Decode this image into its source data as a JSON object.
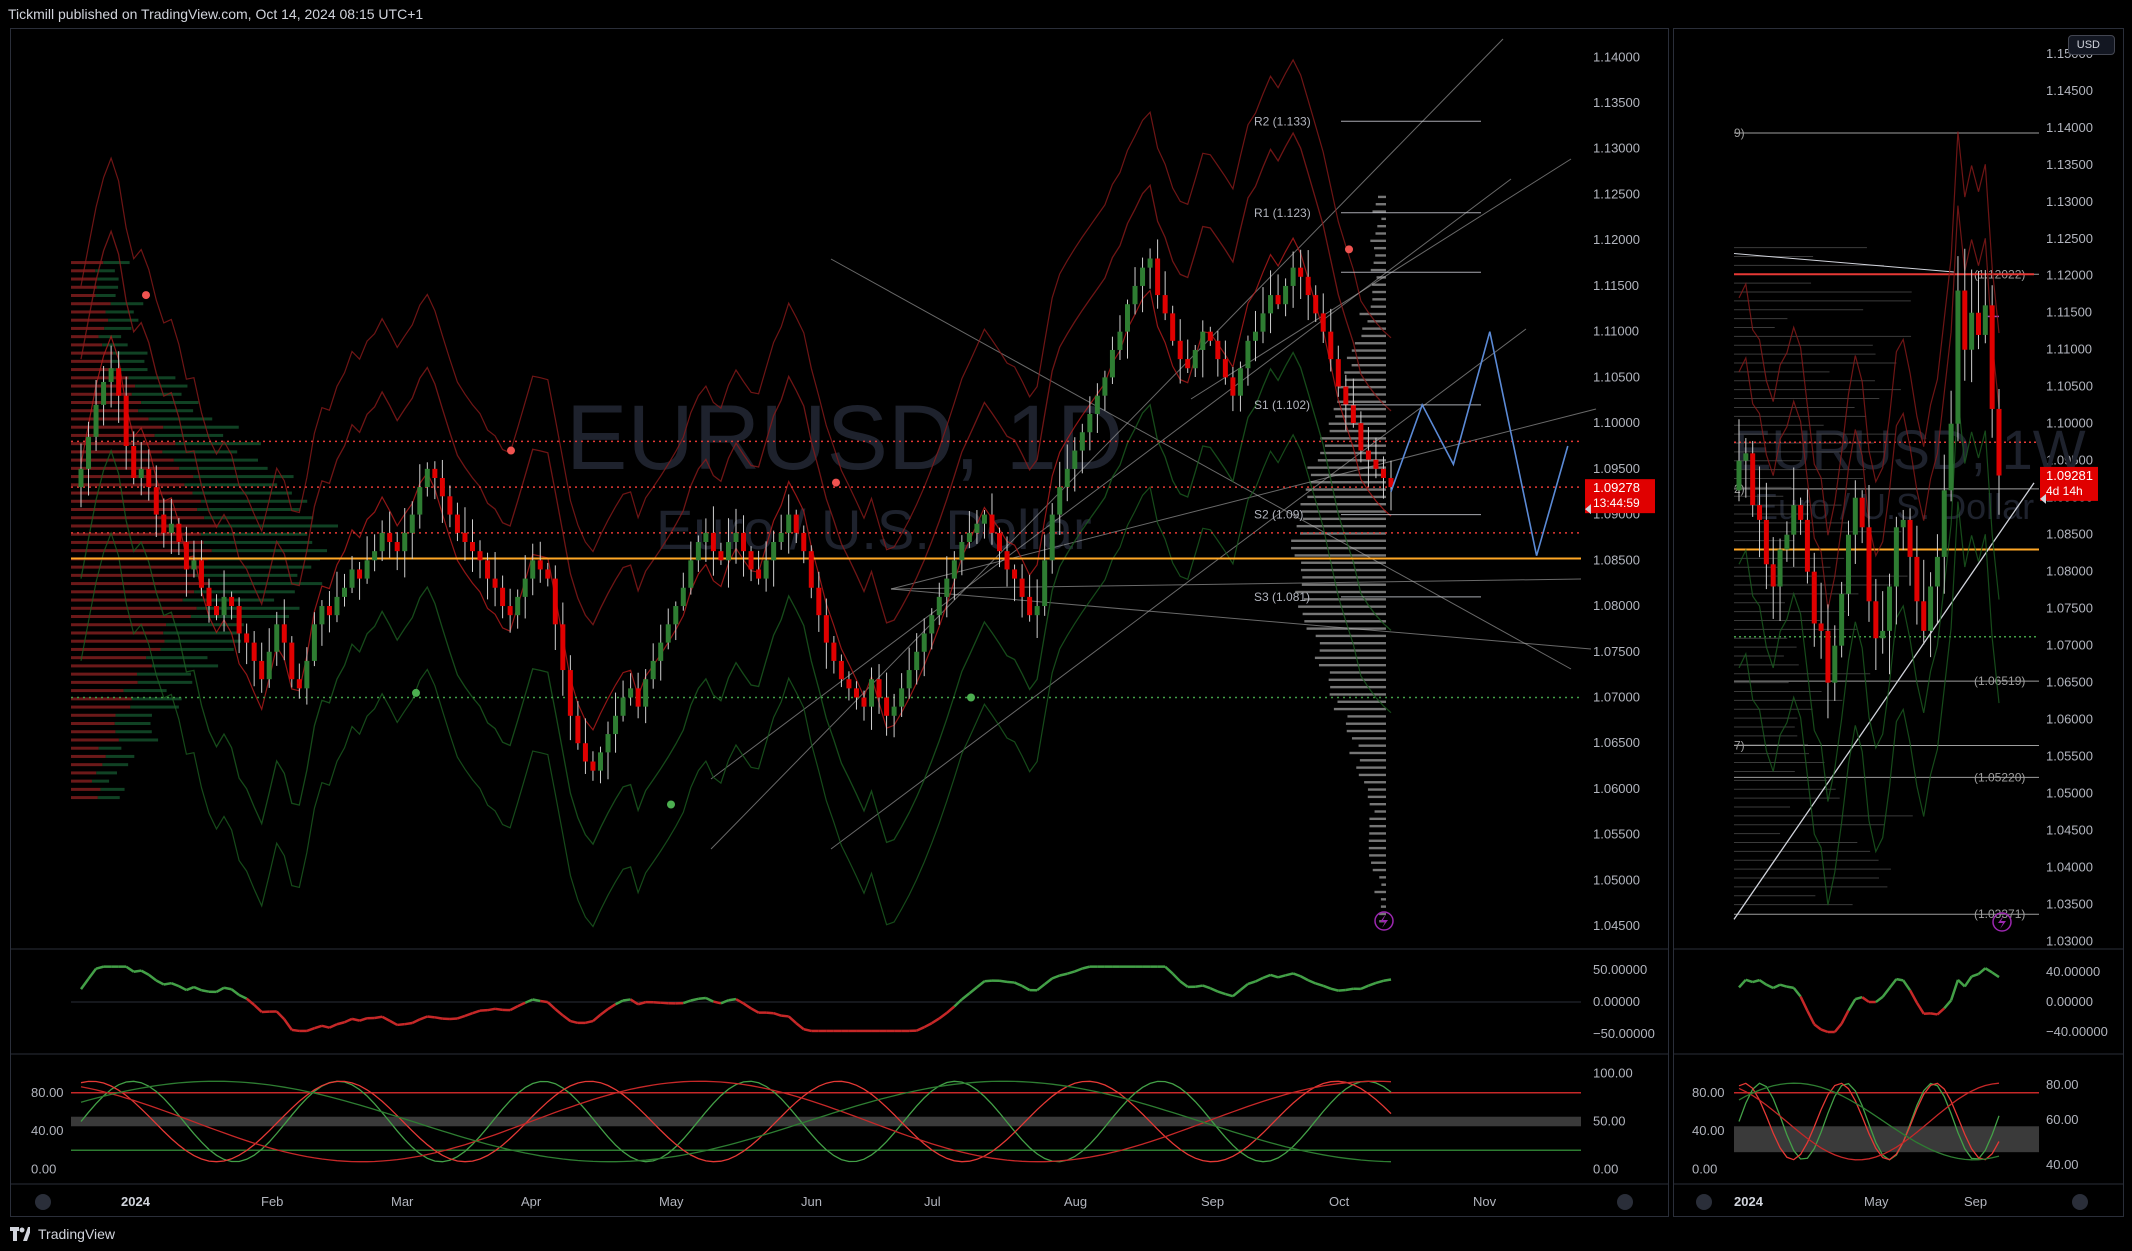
{
  "publisher": "Tickmill published on TradingView.com, Oct 14, 2024 08:15 UTC+1",
  "brand": "TradingView",
  "currency": "USD",
  "colors": {
    "bull": "#2e7d32",
    "bear": "#e00000",
    "grid": "#2a2e39",
    "axis_text": "#b2b5be",
    "price_badge": "#e00000",
    "support_line": "#ffa726"
  },
  "chart_data": [
    {
      "type": "candlestick",
      "watermark_symbol": "EURUSD, 1D",
      "watermark_name": "Euro / U.S. Dollar",
      "x_ticks": [
        "2024",
        "Feb",
        "Mar",
        "Apr",
        "May",
        "Jun",
        "Jul",
        "Aug",
        "Sep",
        "Oct",
        "Nov"
      ],
      "y_ticks": [
        "1.14000",
        "1.13500",
        "1.13000",
        "1.12500",
        "1.12000",
        "1.11500",
        "1.11000",
        "1.10500",
        "1.10000",
        "1.09500",
        "1.09000",
        "1.08500",
        "1.08000",
        "1.07500",
        "1.07000",
        "1.06500",
        "1.06000",
        "1.05500",
        "1.05000",
        "1.04500"
      ],
      "ylim": [
        1.0425,
        1.142
      ],
      "last_price": "1.09278",
      "countdown": "13:44:59",
      "pivot_levels": [
        {
          "label": "R2 (1.133)",
          "value": 1.133
        },
        {
          "label": "R1 (1.123)",
          "value": 1.123
        },
        {
          "label": "",
          "value": 1.1165
        },
        {
          "label": "S1 (1.102)",
          "value": 1.102
        },
        {
          "label": "S2 (1.09)",
          "value": 1.09
        },
        {
          "label": "S3 (1.081)",
          "value": 1.081
        }
      ],
      "horizontal_lines": [
        {
          "value": 1.098,
          "style": "dotted",
          "color": "#e53935"
        },
        {
          "value": 1.093,
          "style": "dotted",
          "color": "#e53935"
        },
        {
          "value": 1.088,
          "style": "dotted",
          "color": "#e53935"
        },
        {
          "value": 1.0852,
          "style": "solid",
          "color": "#ffa726"
        },
        {
          "value": 1.07,
          "style": "dotted",
          "color": "#43a047"
        }
      ],
      "daily_closes": [
        1.095,
        1.0985,
        1.102,
        1.1045,
        1.106,
        1.103,
        1.0975,
        1.094,
        1.095,
        1.093,
        1.09,
        1.088,
        1.089,
        1.087,
        1.084,
        1.085,
        1.082,
        1.08,
        1.079,
        1.081,
        1.08,
        1.077,
        1.076,
        1.074,
        1.072,
        1.075,
        1.078,
        1.076,
        1.072,
        1.071,
        1.074,
        1.078,
        1.08,
        1.079,
        1.081,
        1.082,
        1.084,
        1.083,
        1.085,
        1.086,
        1.088,
        1.087,
        1.086,
        1.088,
        1.09,
        1.093,
        1.095,
        1.094,
        1.092,
        1.09,
        1.088,
        1.087,
        1.086,
        1.085,
        1.083,
        1.082,
        1.08,
        1.079,
        1.081,
        1.083,
        1.085,
        1.084,
        1.083,
        1.078,
        1.073,
        1.068,
        1.065,
        1.063,
        1.062,
        1.064,
        1.066,
        1.068,
        1.07,
        1.071,
        1.069,
        1.072,
        1.074,
        1.076,
        1.078,
        1.08,
        1.082,
        1.085,
        1.087,
        1.088,
        1.086,
        1.085,
        1.087,
        1.088,
        1.086,
        1.084,
        1.083,
        1.085,
        1.087,
        1.088,
        1.09,
        1.088,
        1.086,
        1.082,
        1.079,
        1.076,
        1.074,
        1.072,
        1.071,
        1.07,
        1.069,
        1.072,
        1.07,
        1.068,
        1.069,
        1.071,
        1.073,
        1.075,
        1.077,
        1.079,
        1.081,
        1.083,
        1.085,
        1.087,
        1.088,
        1.089,
        1.09,
        1.088,
        1.086,
        1.084,
        1.083,
        1.081,
        1.079,
        1.08,
        1.085,
        1.09,
        1.093,
        1.095,
        1.097,
        1.099,
        1.101,
        1.103,
        1.105,
        1.108,
        1.11,
        1.113,
        1.115,
        1.117,
        1.118,
        1.114,
        1.112,
        1.109,
        1.107,
        1.106,
        1.108,
        1.11,
        1.109,
        1.107,
        1.105,
        1.103,
        1.106,
        1.109,
        1.11,
        1.112,
        1.114,
        1.113,
        1.115,
        1.117,
        1.116,
        1.114,
        1.112,
        1.11,
        1.107,
        1.104,
        1.102,
        1.1,
        1.097,
        1.096,
        1.095,
        1.094,
        1.093
      ],
      "bull_closes_green": true,
      "projection_path": [
        [
          0,
          1.0925
        ],
        [
          6,
          1.102
        ],
        [
          12,
          1.0955
        ],
        [
          19,
          1.11
        ],
        [
          28,
          1.0855
        ],
        [
          34,
          1.0975
        ]
      ]
    },
    {
      "type": "line",
      "name": "oscillator",
      "y_ticks": [
        "50.00000",
        "0.00000",
        "−50.00000"
      ],
      "ylim": [
        -70,
        70
      ]
    },
    {
      "type": "line",
      "name": "stochastic",
      "left_ticks": [
        "80.00",
        "40.00",
        "0.00"
      ],
      "right_ticks": [
        "100.00",
        "50.00",
        "0.00"
      ],
      "ylim": [
        -10,
        110
      ],
      "levels": [
        80,
        50,
        20
      ]
    },
    {
      "type": "candlestick",
      "watermark_symbol": "EURUSD, 1W",
      "watermark_name": "Euro / U.S. Dollar",
      "x_ticks": [
        "2024",
        "May",
        "Sep"
      ],
      "y_ticks": [
        "1.15000",
        "1.14500",
        "1.14000",
        "1.13500",
        "1.13000",
        "1.12500",
        "1.12000",
        "1.11500",
        "1.11000",
        "1.10500",
        "1.10000",
        "1.09500",
        "1.09000",
        "1.08500",
        "1.08000",
        "1.07500",
        "1.07000",
        "1.06500",
        "1.06000",
        "1.05500",
        "1.05000",
        "1.04500",
        "1.04000",
        "1.03500",
        "1.03000"
      ],
      "ylim": [
        1.029,
        1.152
      ],
      "last_price": "1.09281",
      "countdown": "4d 14h",
      "labels": [
        {
          "label": "9)",
          "value": 1.1393
        },
        {
          "label": "(1.12022)",
          "value": 1.1202
        },
        {
          "label": "2)",
          "value": 1.0912
        },
        {
          "label": "(1.06519)",
          "value": 1.0652
        },
        {
          "label": "7)",
          "value": 1.0565
        },
        {
          "label": "(1.05220)",
          "value": 1.0522
        },
        {
          "label": "(1.03371)",
          "value": 1.0337
        }
      ],
      "weekly_closes": [
        1.095,
        1.096,
        1.089,
        1.087,
        1.081,
        1.078,
        1.083,
        1.085,
        1.089,
        1.087,
        1.08,
        1.073,
        1.072,
        1.065,
        1.07,
        1.077,
        1.085,
        1.09,
        1.086,
        1.076,
        1.071,
        1.072,
        1.078,
        1.086,
        1.087,
        1.082,
        1.076,
        1.072,
        1.078,
        1.082,
        1.091,
        1.1,
        1.118,
        1.11,
        1.115,
        1.112,
        1.116,
        1.102,
        1.093
      ],
      "osc_ticks": [
        "40.00000",
        "0.00000",
        "−40.00000"
      ],
      "stoch_left_ticks": [
        "80.00",
        "40.00",
        "0.00"
      ],
      "stoch_right_ticks": [
        "80.00",
        "60.00",
        "40.00"
      ]
    }
  ]
}
